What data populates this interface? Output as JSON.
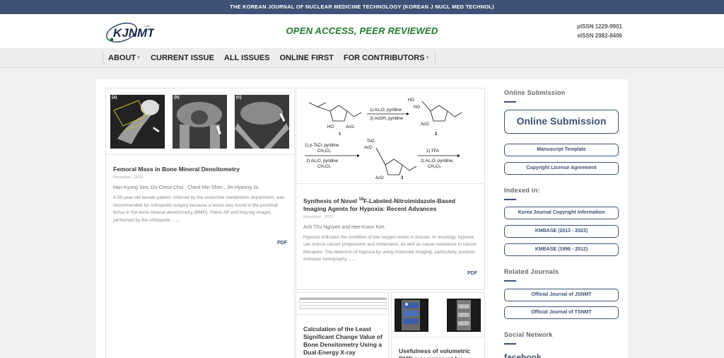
{
  "topbar": {
    "title": "THE KOREAN JOURNAL OF NUCLEAR MEDICINE TECHNOLOGY (KOREAN J NUCL MED TECHNOL)"
  },
  "header": {
    "logo_text": "KJNMT",
    "logo_year": "1997",
    "tagline": "OPEN ACCESS, PEER REVIEWED",
    "pissn": "pISSN 1229-9901",
    "eissn": "eISSN 2982-8406"
  },
  "nav": {
    "items": [
      {
        "label": "ABOUT",
        "dropdown": true
      },
      {
        "label": "CURRENT ISSUE",
        "dropdown": false
      },
      {
        "label": "ALL ISSUES",
        "dropdown": false
      },
      {
        "label": "ONLINE FIRST",
        "dropdown": false
      },
      {
        "label": "FOR CONTRIBUTORS",
        "dropdown": true
      }
    ]
  },
  "articles": [
    {
      "title": "Femoral Mass in Bone Mineral Densitometry",
      "date": "November , 2023",
      "authors": "Han-Kyung Seo, Do-Cheol Choi , Cheol-Min Shim , Jin-Hyeong Jo",
      "abstract": "A 55-year-old female patient, referred by the endocrine metabolism department, was recommended for orthopedic surgery because a lesion was found in the proximal femur in the bone mineral densitometry (BMD). Pelvis AP and frog-leg images performed by the orthopedic ......",
      "pdf": "PDF",
      "image_labels": [
        "(a)",
        "(b)",
        "(c)"
      ]
    },
    {
      "title_pre": "Synthesis of Novel ",
      "title_sup": "18",
      "title_post": "F-Labeled-Nitroimidazole-Based Imaging Agents for Hypoxia: Recent Advances",
      "date": "November , 2023",
      "authors": "Anh Thu Nguyen and Hee-Kwon Kim",
      "abstract": "Hypoxia indicates the condition of low oxygen levels in tissues. In oncology, hypoxia can induce cancer progression and metastasis, as well as cause resistance to cancer therapies. The detection of hypoxia by using molecular imaging, particularly, positron emission tomography ......",
      "pdf": "PDF",
      "scheme": {
        "step1_a": "1) Ac₂O, pyridine",
        "step1_b": "2) AcOH, pyridine",
        "step2_a": "1) p-TsCl, pyridine",
        "step2_b": "CH₂Cl₂",
        "step2_c": "2) Ac₂O, pyridine",
        "step2_d": "CH₂Cl₂",
        "step3_a": "1) TFA",
        "step3_b": "2) Ac₂O, pyridine,",
        "step3_c": "CH₂Cl₂",
        "cmpd1": "1",
        "cmpd2": "2",
        "cmpd3": "3",
        "ho": "HO",
        "aco": "AcO",
        "tso": "TsO"
      }
    },
    {
      "title": "Calculation of the Least Significant Change Value of Bone Densitometry Using a Dual-Energy X-ray Absorptiometry S..."
    },
    {
      "title": "Usefulness of volumetric BMD measurement by..."
    }
  ],
  "sidebar": {
    "online_submission_head": "Online Submission",
    "online_submission_btn": "Online Submission",
    "manuscript_template": "Manuscript Template",
    "copyright_agreement": "Copyright License Agreement",
    "indexed_head": "Indexed in:",
    "indexed": [
      "Korea Journal Copyright Information",
      "KMBASE (2013 - 2023)",
      "KMBASE (1996 - 2012)"
    ],
    "related_head": "Related Journals",
    "related": [
      "Official Journal of JSNMT",
      "Official Journal of TSNMT"
    ],
    "social_head": "Social Network",
    "facebook": "facebook"
  },
  "colors": {
    "navy": "#3d5275",
    "green": "#1f7a2d"
  }
}
